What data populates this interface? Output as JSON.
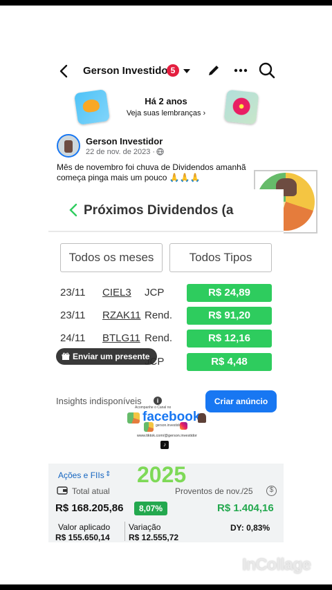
{
  "header": {
    "title": "Gerson Investidor",
    "badge_count": "5"
  },
  "memories": {
    "title": "Há 2 anos",
    "subtitle": "Veja suas lembranças ›"
  },
  "post": {
    "author": "Gerson Investidor",
    "date": "22 de nov. de 2023 · ",
    "text": "Mês de novembro foi chuva de Dividendos amanhã começa pinga  mais um pouco 🙏🙏🙏"
  },
  "card": {
    "title": "Próximos Dividendos (a",
    "filter_months": "Todos os meses",
    "filter_types": "Todos Tipos",
    "rows": [
      {
        "date": "23/11",
        "ticker": "CIEL3",
        "type": "JCP",
        "value": "R$ 24,89"
      },
      {
        "date": "23/11",
        "ticker": "RZAK11",
        "type": "Rend.",
        "value": "R$ 91,20"
      },
      {
        "date": "24/11",
        "ticker": "BTLG11",
        "type": "Rend.",
        "value": "R$ 12,16"
      },
      {
        "date": "",
        "ticker": "",
        "type": "JCP",
        "value": "R$ 4,48"
      }
    ]
  },
  "gift": {
    "label": "Enviar um presente"
  },
  "insights": {
    "label": "Insights indisponíveis",
    "cta": "Criar anúncio"
  },
  "sticker": {
    "top_text": "Acompanhe o Canal no",
    "facebook": "facebook",
    "handle": "gerson.investidor",
    "url": "www.tiktok.com/@gerson.investidor"
  },
  "panel": {
    "selector": "Ações e FIIs",
    "year": "2025",
    "total_label": "Total atual",
    "proventos_label": "Proventos de nov./25",
    "total_value": "R$ 168.205,86",
    "total_pct": "8,07%",
    "proventos_value": "R$ 1.404,16",
    "aplicado_label": "Valor aplicado",
    "aplicado_value": "R$ 155.650,14",
    "variacao_label": "Variação",
    "variacao_value": "R$ 12.555,72",
    "dy": "DY: 0,83%"
  },
  "watermark": "InCollage",
  "colors": {
    "facebook_blue": "#1877f2",
    "green_chip": "#2ecc5e",
    "notification_red": "#e41e3f",
    "year_green": "#7ed957"
  }
}
